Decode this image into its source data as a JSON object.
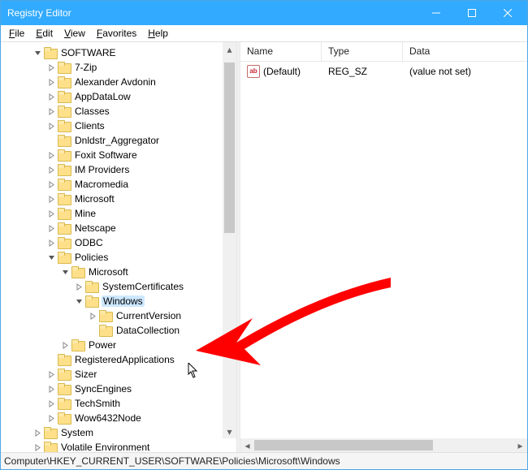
{
  "window": {
    "title": "Registry Editor"
  },
  "menu": {
    "file": "File",
    "edit": "Edit",
    "view": "View",
    "favorites": "Favorites",
    "help": "Help"
  },
  "columns": {
    "name": "Name",
    "type": "Type",
    "data": "Data"
  },
  "colw": {
    "name": 100,
    "type": 100,
    "data": 120
  },
  "values": [
    {
      "name": "(Default)",
      "type": "REG_SZ",
      "data": "(value not set)"
    }
  ],
  "statusbar": {
    "path": "Computer\\HKEY_CURRENT_USER\\SOFTWARE\\Policies\\Microsoft\\Windows"
  },
  "tree": [
    {
      "depth": 2,
      "exp": "open",
      "label": "SOFTWARE"
    },
    {
      "depth": 3,
      "exp": "closed",
      "label": "7-Zip"
    },
    {
      "depth": 3,
      "exp": "closed",
      "label": "Alexander Avdonin"
    },
    {
      "depth": 3,
      "exp": "closed",
      "label": "AppDataLow"
    },
    {
      "depth": 3,
      "exp": "closed",
      "label": "Classes"
    },
    {
      "depth": 3,
      "exp": "closed",
      "label": "Clients"
    },
    {
      "depth": 3,
      "exp": "none",
      "label": "Dnldstr_Aggregator"
    },
    {
      "depth": 3,
      "exp": "closed",
      "label": "Foxit Software"
    },
    {
      "depth": 3,
      "exp": "closed",
      "label": "IM Providers"
    },
    {
      "depth": 3,
      "exp": "closed",
      "label": "Macromedia"
    },
    {
      "depth": 3,
      "exp": "closed",
      "label": "Microsoft"
    },
    {
      "depth": 3,
      "exp": "closed",
      "label": "Mine"
    },
    {
      "depth": 3,
      "exp": "closed",
      "label": "Netscape"
    },
    {
      "depth": 3,
      "exp": "closed",
      "label": "ODBC"
    },
    {
      "depth": 3,
      "exp": "open",
      "label": "Policies"
    },
    {
      "depth": 4,
      "exp": "open",
      "label": "Microsoft"
    },
    {
      "depth": 5,
      "exp": "closed",
      "label": "SystemCertificates"
    },
    {
      "depth": 5,
      "exp": "open",
      "label": "Windows",
      "selected": true
    },
    {
      "depth": 6,
      "exp": "closed",
      "label": "CurrentVersion"
    },
    {
      "depth": 6,
      "exp": "none",
      "label": "DataCollection"
    },
    {
      "depth": 4,
      "exp": "closed",
      "label": "Power"
    },
    {
      "depth": 3,
      "exp": "none",
      "label": "RegisteredApplications"
    },
    {
      "depth": 3,
      "exp": "closed",
      "label": "Sizer"
    },
    {
      "depth": 3,
      "exp": "closed",
      "label": "SyncEngines"
    },
    {
      "depth": 3,
      "exp": "closed",
      "label": "TechSmith"
    },
    {
      "depth": 3,
      "exp": "closed",
      "label": "Wow6432Node"
    },
    {
      "depth": 2,
      "exp": "closed",
      "label": "System"
    },
    {
      "depth": 2,
      "exp": "closed",
      "label": "Volatile Environment"
    }
  ],
  "icons": {
    "ab": "ab"
  },
  "annotation": {
    "color": "#ff0000"
  }
}
